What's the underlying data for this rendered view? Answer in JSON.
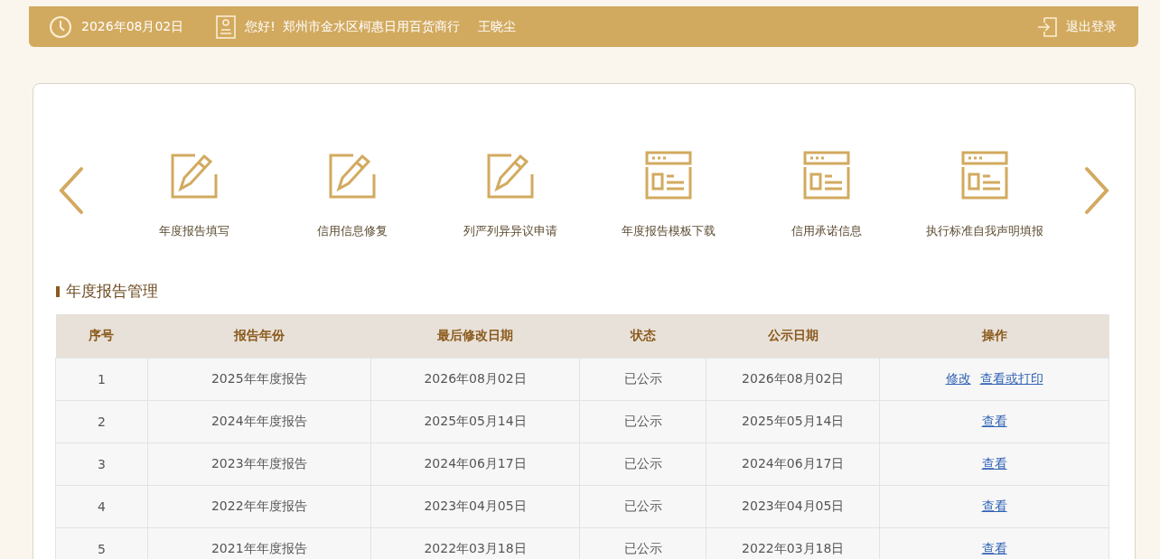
{
  "header": {
    "date": "2026年08月02日",
    "greeting": "您好!",
    "company": "郑州市金水区柯惠日用百货商行",
    "user": "王晓尘",
    "logout": "退出登录"
  },
  "shortcuts": [
    {
      "kind": "edit",
      "label": "年度报告填写"
    },
    {
      "kind": "edit",
      "label": "信用信息修复"
    },
    {
      "kind": "edit",
      "label": "列严列异异议申请"
    },
    {
      "kind": "page",
      "label": "年度报告模板下载"
    },
    {
      "kind": "page",
      "label": "信用承诺信息"
    },
    {
      "kind": "page",
      "label": "执行标准自我声明填报"
    }
  ],
  "section_title": "年度报告管理",
  "table": {
    "columns": [
      "序号",
      "报告年份",
      "最后修改日期",
      "状态",
      "公示日期",
      "操作"
    ],
    "rows": [
      {
        "cells": [
          "1",
          "2025年年度报告",
          "2026年08月02日",
          "已公示",
          "2026年08月02日"
        ],
        "actions": [
          "修改",
          "查看或打印"
        ]
      },
      {
        "cells": [
          "2",
          "2024年年度报告",
          "2025年05月14日",
          "已公示",
          "2025年05月14日"
        ],
        "actions": [
          "查看"
        ]
      },
      {
        "cells": [
          "3",
          "2023年年度报告",
          "2024年06月17日",
          "已公示",
          "2024年06月17日"
        ],
        "actions": [
          "查看"
        ]
      },
      {
        "cells": [
          "4",
          "2022年年度报告",
          "2023年04月05日",
          "已公示",
          "2023年04月05日"
        ],
        "actions": [
          "查看"
        ]
      },
      {
        "cells": [
          "5",
          "2021年年度报告",
          "2022年03月18日",
          "已公示",
          "2022年03月18日"
        ],
        "actions": [
          "查看"
        ]
      }
    ]
  }
}
